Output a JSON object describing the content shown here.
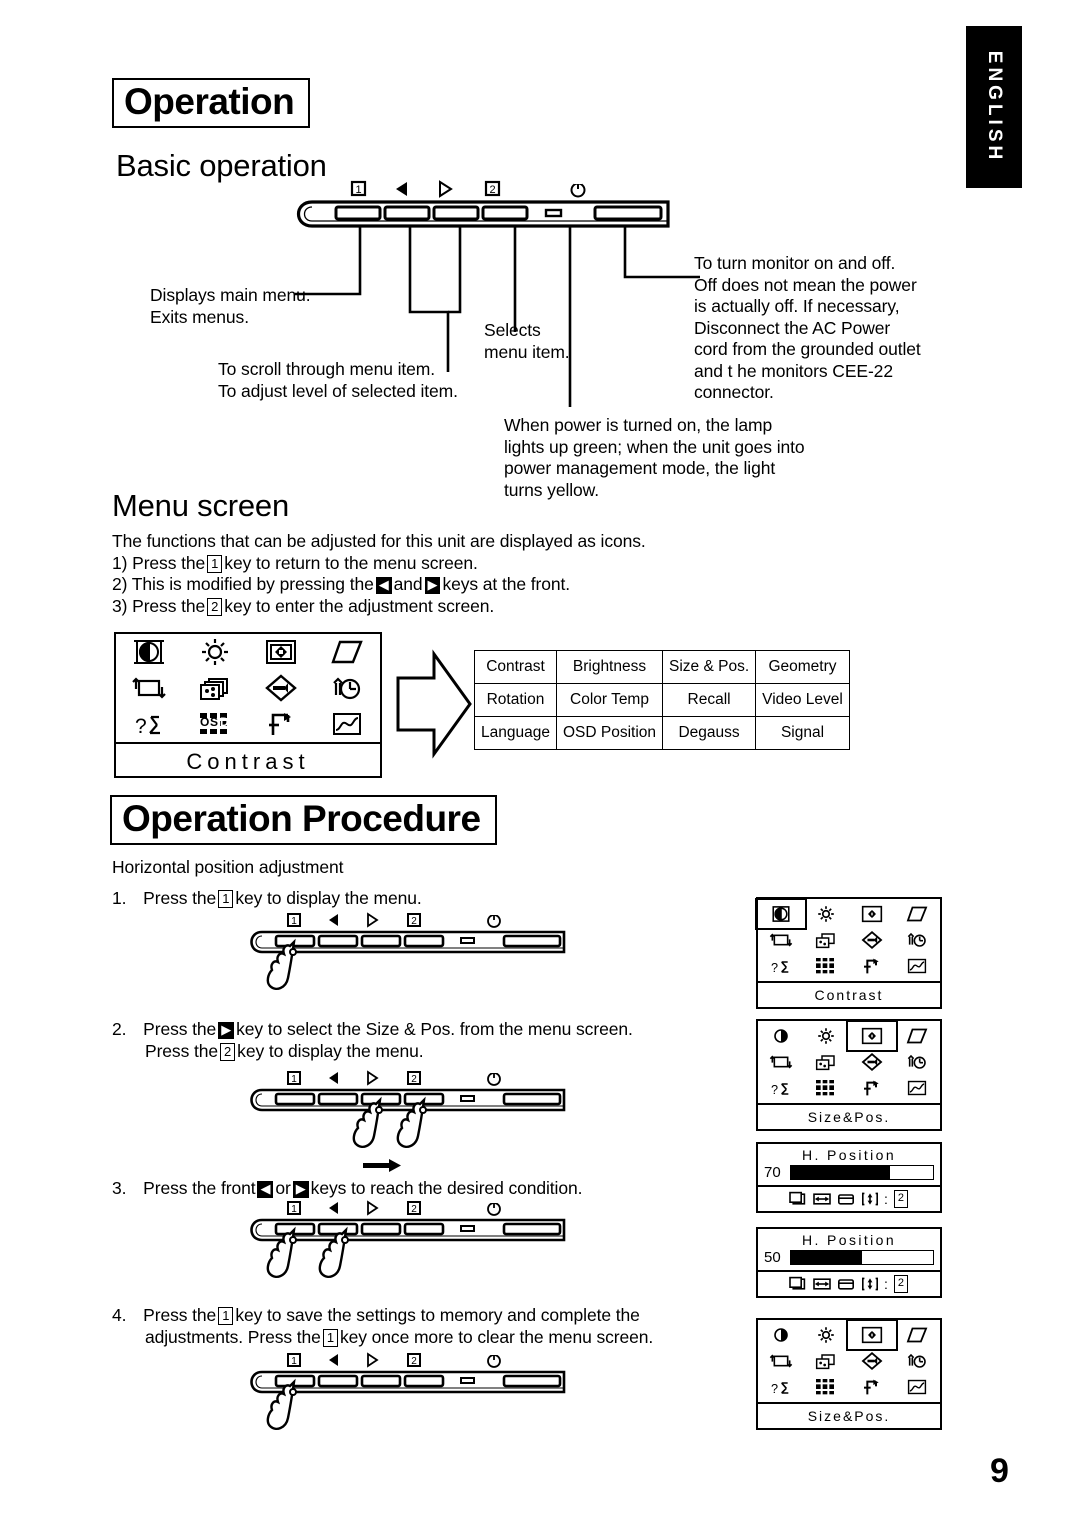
{
  "side_tab": {
    "label": "ENGLISH"
  },
  "page_number": "9",
  "headings": {
    "operation": "Operation",
    "basic_operation": "Basic operation",
    "menu_screen": "Menu screen",
    "operation_procedure": "Operation Procedure",
    "horizontal_position": "Horizontal position adjustment"
  },
  "panel_keys": {
    "key1": "1",
    "left": "◁",
    "right": "▷",
    "key2": "2",
    "power": "⏻"
  },
  "callouts": {
    "menu_key": "Displays main menu.\nExits menus.",
    "menu_key_line1": "Displays main menu.",
    "menu_key_line2": "Exits menus.",
    "arrows": "To scroll through menu item.\nTo adjust level of selected item.",
    "arrows_line1": "To scroll through menu item.",
    "arrows_line2": "To adjust level of selected item.",
    "select": "Selects\nmenu item.",
    "select_line1": "Selects",
    "select_line2": "menu item.",
    "power": "To turn monitor on and off. Off does not mean the power is actually off. If necessary, Disconnect the AC Power cord from the grounded outlet and t he monitors CEE-22 connector.",
    "power_lines": [
      "To turn monitor on and off.",
      "Off does not mean the power",
      "is actually off. If necessary,",
      "Disconnect the AC Power",
      "cord from the grounded outlet",
      "and t he monitors CEE-22",
      "connector."
    ],
    "lamp": "When power is turned on, the lamp lights up green; when the unit goes into power management mode, the light turns yellow.",
    "lamp_lines": [
      "When power is turned on, the lamp",
      "lights up green; when the unit goes into",
      "power management mode, the light",
      "turns yellow."
    ]
  },
  "menu_screen": {
    "intro": "The functions that can be adjusted for this unit are displayed as icons.",
    "step1_a": "1) Press the",
    "step1_key": "1",
    "step1_b": "key to return to the menu screen.",
    "step2_a": "2) This is modified by pressing the",
    "step2_key_left": "◀",
    "step2_mid": "and",
    "step2_key_right": "▶",
    "step2_b": "keys at the front.",
    "step3_a": "3) Press the",
    "step3_key": "2",
    "step3_b": "key to enter the adjustment screen."
  },
  "osd_icons": [
    "contrast-icon",
    "brightness-icon",
    "size-and-position-icon",
    "geometry-icon",
    "rotation-icon",
    "color-temp-icon",
    "recall-icon",
    "degauss-icon",
    "language-icon",
    "osd-position-icon",
    "moire-icon",
    "video-level-icon"
  ],
  "osd_panels": {
    "contrast_title": "Contrast",
    "size_pos_title": "Size&Pos.",
    "h_position_title": "H. Position",
    "value_70": "70",
    "value_50": "50",
    "bar_70_percent": 70,
    "bar_50_percent": 50,
    "adjust_icons": [
      "h-position-icon",
      "h-size-icon",
      "v-position-icon",
      "v-size-icon"
    ],
    "adjust_separator": ":",
    "adjust_key": "2"
  },
  "menu_table": {
    "rows": [
      [
        "Contrast",
        "Brightness",
        "Size & Pos.",
        "Geometry"
      ],
      [
        "Rotation",
        "Color Temp",
        "Recall",
        "Video Level"
      ],
      [
        "Language",
        "OSD Position",
        "Degauss",
        "Signal"
      ]
    ]
  },
  "procedure": {
    "steps": [
      {
        "num": "1.",
        "line1_a": "Press the",
        "key": "1",
        "line1_b": "key to display the menu.",
        "line2_a": "",
        "key2": "",
        "line2_b": ""
      },
      {
        "num": "2.",
        "line1_a": "Press the",
        "key": "▶",
        "line1_b": "key to select the Size & Pos. from the menu screen.",
        "line2_a": "Press the",
        "key2": "2",
        "line2_b": "key to display the menu."
      },
      {
        "num": "3.",
        "line1_a": "Press the front",
        "key": "◀",
        "line1_mid": "or",
        "key_b": "▶",
        "line1_b": "keys to reach the desired condition.",
        "line2_a": "",
        "key2": "",
        "line2_b": ""
      },
      {
        "num": "4.",
        "line1_a": "Press the",
        "key": "1",
        "line1_b": "key to save the settings to memory and complete the",
        "line2_a": "adjustments. Press the",
        "key2": "1",
        "line2_b": "key once more to clear the menu screen."
      }
    ]
  }
}
